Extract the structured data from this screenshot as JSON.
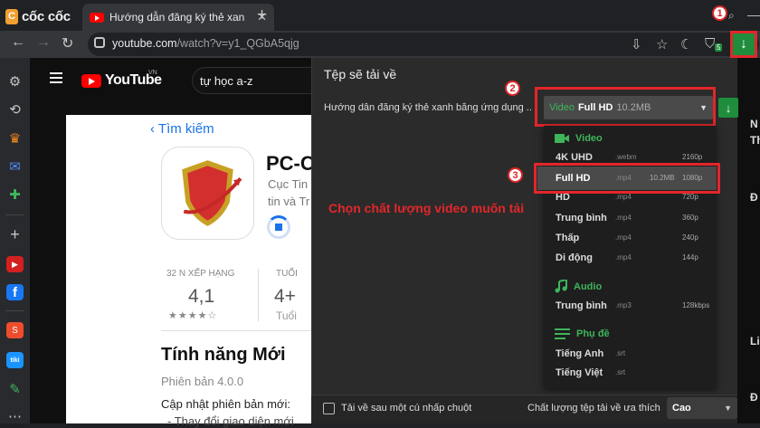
{
  "browser": {
    "brand": "cốc cốc",
    "tab_title": "Hướng dẫn đăng ký thẻ xanh",
    "tab_close": "✕",
    "new_tab": "+",
    "url_host": "youtube.com",
    "url_path": "/watch?v=y1_QGbA5qjg",
    "extension_badge": "5"
  },
  "youtube": {
    "logo_text": "YouTube",
    "region": "VN",
    "search_value": "tự học a-z"
  },
  "video_content": {
    "back_label": "Tìm kiếm",
    "app_name": "PC-C",
    "app_sub1": "Cục Tin",
    "app_sub2": "tin và Tr",
    "rank_label": "32 N XẾP HẠNG",
    "rank_value": "4,1",
    "rank_stars": "★★★★☆",
    "age_label": "TUỔI",
    "age_value": "4+",
    "age_sub": "Tuổi",
    "whats_new": "Tính năng Mới",
    "version": "Phiên bản 4.0.0",
    "update_line1": "Cập nhật phiên bản mới:",
    "update_line2": "- Thay đổi giao diện mới"
  },
  "download_panel": {
    "title": "Tệp sẽ tải về",
    "video_title": "Hướng dẫn đăng ký thẻ xanh bằng ứng dụng ...",
    "selected": {
      "kind": "Video",
      "quality": "Full HD",
      "size": "10.2MB"
    },
    "sections": [
      {
        "name": "Video",
        "icon": "video-camera-icon",
        "items": [
          {
            "label": "4K UHD",
            "ext": ".webm",
            "size": "",
            "res": "2160p"
          },
          {
            "label": "Full HD",
            "ext": ".mp4",
            "size": "10.2MB",
            "res": "1080p"
          },
          {
            "label": "HD",
            "ext": ".mp4",
            "size": "",
            "res": "720p"
          },
          {
            "label": "Trung bình",
            "ext": ".mp4",
            "size": "",
            "res": "360p"
          },
          {
            "label": "Thấp",
            "ext": ".mp4",
            "size": "",
            "res": "240p"
          },
          {
            "label": "Di động",
            "ext": ".mp4",
            "size": "",
            "res": "144p"
          }
        ]
      },
      {
        "name": "Audio",
        "icon": "music-note-icon",
        "items": [
          {
            "label": "Trung bình",
            "ext": ".mp3",
            "size": "",
            "res": "128kbps"
          }
        ]
      },
      {
        "name": "Phụ đề",
        "icon": "subtitles-icon",
        "items": [
          {
            "label": "Tiếng Anh",
            "ext": ".srt",
            "size": "",
            "res": ""
          },
          {
            "label": "Tiếng Việt",
            "ext": ".srt",
            "size": "",
            "res": ""
          }
        ]
      }
    ],
    "footer_checkbox": "Tải về sau một cú nhấp chuột",
    "footer_pref_label": "Chất lượng tệp tải về ưa thích",
    "footer_pref_value": "Cao"
  },
  "annotations": {
    "step1": "1",
    "step2": "2",
    "step3": "3",
    "caption": "Chọn chất lượng video muốn tải",
    "highlight_color": "#e3262a"
  },
  "right_page": {
    "lines": [
      "N",
      "Th",
      "Đ",
      "Li",
      "Đ"
    ]
  }
}
